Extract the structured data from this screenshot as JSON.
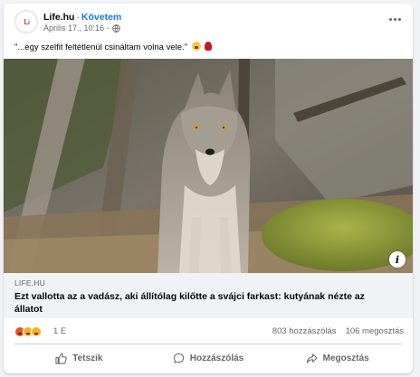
{
  "post": {
    "author": "Life.hu",
    "separator": "·",
    "follow_label": "Követem",
    "timestamp": "Április 17., 10:16",
    "meta_separator": "·",
    "caption": "\"...egy szelfit feltétlenül csináltam volna vele.\"",
    "avatar_logo_text": "Life",
    "more_icon": "more-horizontal-icon",
    "privacy_icon": "globe-icon"
  },
  "link": {
    "domain": "LIFE.HU",
    "title": "Ezt vallotta az a vadász, aki állítólag kilőtte a svájci farkast: kutyának nézte az állatot",
    "info_glyph": "i"
  },
  "reactions": {
    "count": "1 E",
    "comments": "803 hozzászólás",
    "shares": "106 megosztás",
    "icons": [
      "angry-reaction-icon",
      "sad-reaction-icon",
      "care-reaction-icon"
    ]
  },
  "actions": {
    "like_label": "Tetszik",
    "comment_label": "Hozzászólás",
    "share_label": "Megosztás"
  },
  "colors": {
    "accent": "#1877f2",
    "secondary_text": "#65676b",
    "background": "#f0f2f5"
  }
}
